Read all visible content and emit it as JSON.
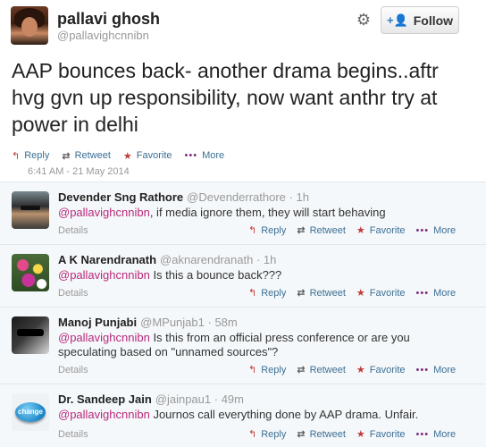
{
  "tweet": {
    "author_name": "pallavi ghosh",
    "author_handle": "@pallavighcnnibn",
    "follow_label": "Follow",
    "text": "AAP bounces back- another drama begins..aftr hvg gvn up responsibility, now want anthr try at power in delhi",
    "timestamp": "6:41 AM - 21 May 2014",
    "actions": {
      "reply": "Reply",
      "retweet": "Retweet",
      "favorite": "Favorite",
      "more": "More"
    }
  },
  "replies": [
    {
      "name": "Devender Sng Rathore",
      "handle": "@Devenderrathore",
      "time": "· 1h",
      "mention": "@pallavighcnnibn",
      "text": ", if media ignore them, they will start behaving",
      "details": "Details",
      "avatar_icon": "man-with-sunglasses-avatar"
    },
    {
      "name": "A K Narendranath",
      "handle": "@aknarendranath",
      "time": "· 1h",
      "mention": "@pallavighcnnibn",
      "text": " Is this a bounce back???",
      "details": "Details",
      "avatar_icon": "flowers-avatar"
    },
    {
      "name": "Manoj Punjabi",
      "handle": "@MPunjab1",
      "time": "· 58m",
      "mention": "@pallavighcnnibn",
      "text": " Is this from an official press conference or are you speculating based on \"unnamed sources\"?",
      "details": "Details",
      "avatar_icon": "sunglasses-face-avatar"
    },
    {
      "name": "Dr. Sandeep Jain",
      "handle": "@jainpau1",
      "time": "· 49m",
      "mention": "@pallavighcnnibn",
      "text": " Journos call everything done by AAP drama. Unfair.",
      "details": "Details",
      "avatar_icon": "change-button-avatar"
    }
  ],
  "reply_actions": {
    "reply": "Reply",
    "retweet": "Retweet",
    "favorite": "Favorite",
    "more": "More"
  },
  "colors": {
    "mention": "#b9297c",
    "link": "#3b6f95",
    "icon_red": "#c23a3a",
    "follow_icon": "#2b7bb9"
  }
}
